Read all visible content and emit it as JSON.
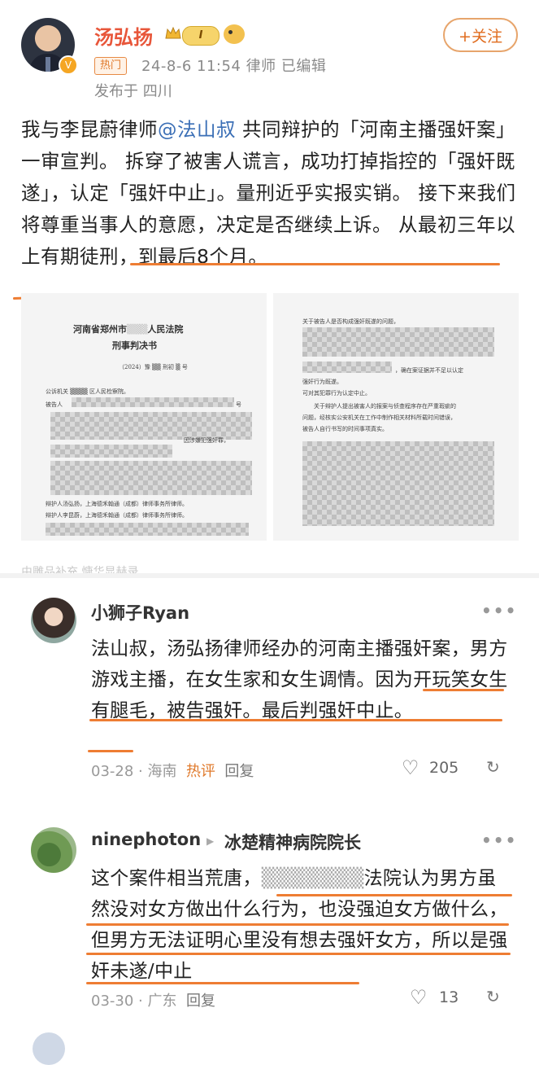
{
  "post": {
    "author": "汤弘扬",
    "level": "I",
    "follow_label": "+关注",
    "hot_tag": "热门",
    "meta": "24-8-6 11:54  律师  已编辑",
    "location": "发布于 四川",
    "text_before": "我与李昆蔚律师",
    "mention": "@法山叔",
    "text_after": " 共同辩护的「河南主播强奸案」一审宣判。 拆穿了被害人谎言，成功打掉指控的「强奸既遂」，认定「强奸中止」。量刑近乎实报实销。 接下来我们将尊重当事人的意愿，决定是否继续上诉。 从最初三年以上有期徒刑，到最后8个月。",
    "doc1": {
      "court": "河南省郑州市",
      "court_suffix": "人民法院",
      "doc_type": "刑事判决书",
      "case_no_a": "（2024）豫",
      "case_no_b": "刑初",
      "case_no_c": "号",
      "prosecutor_a": "公诉机关",
      "prosecutor_b": "区人民检察院。",
      "defendant": "被告人",
      "defendant_end": "号",
      "detained": "因涉嫌犯强奸罪，",
      "lawyer1": "辩护人汤弘扬，上海德禾翰通（成都）律师事务所律师。",
      "lawyer2": "辩护人李昆蔚，上海德禾翰通（成都）律师事务所律师。"
    },
    "doc2": {
      "l1": "关于被告人是否构成强奸既遂的问题，",
      "l2": "，确在案证据并不足以认定",
      "l3": "强奸行为既遂。",
      "l4": "可对其犯罪行为认定中止。",
      "l5": "关于辩护人提出被害人的报案与侦查程序存在严重瑕疵的",
      "l6": "问题，经核实公安机关在工作中制作相关材料所载时间错误，",
      "l7": "被告人自行书写的时间事项真实。"
    },
    "clipped_text": "由雕品补充  慷华显赫录"
  },
  "comments": [
    {
      "name": "小狮子Ryan",
      "text": "法山叔，汤弘扬律师经办的河南主播强奸案，男方游戏主播，在女生家和女生调情。因为开玩笑女生有腿毛，被告强奸。最后判强奸中止。",
      "date": "03-28",
      "location": "海南",
      "hot": "热评",
      "reply": "回复",
      "likes": "205",
      "more": "•••"
    },
    {
      "name": "ninephoton",
      "reply_to": "冰楚精神病院院长",
      "text_a": "这个案件相当荒唐，",
      "text_b": "法院认为男方虽然没对女方做出什么行为，也没强迫女方做什么，但男方无法证明心里没有想去强奸女方，所以是强奸未遂/中止",
      "date": "03-30",
      "location": "广东",
      "reply": "回复",
      "likes": "13",
      "more": "•••"
    }
  ],
  "icons": {
    "heart": "heart-outline-icon",
    "repost": "repost-icon",
    "more": "more-icon",
    "verified": "verified-badge-icon"
  },
  "colors": {
    "name_orange": "#e8563a",
    "accent": "#ee7d33",
    "mention_blue": "#3b6fb6",
    "meta_gray": "#8a8a8a"
  }
}
